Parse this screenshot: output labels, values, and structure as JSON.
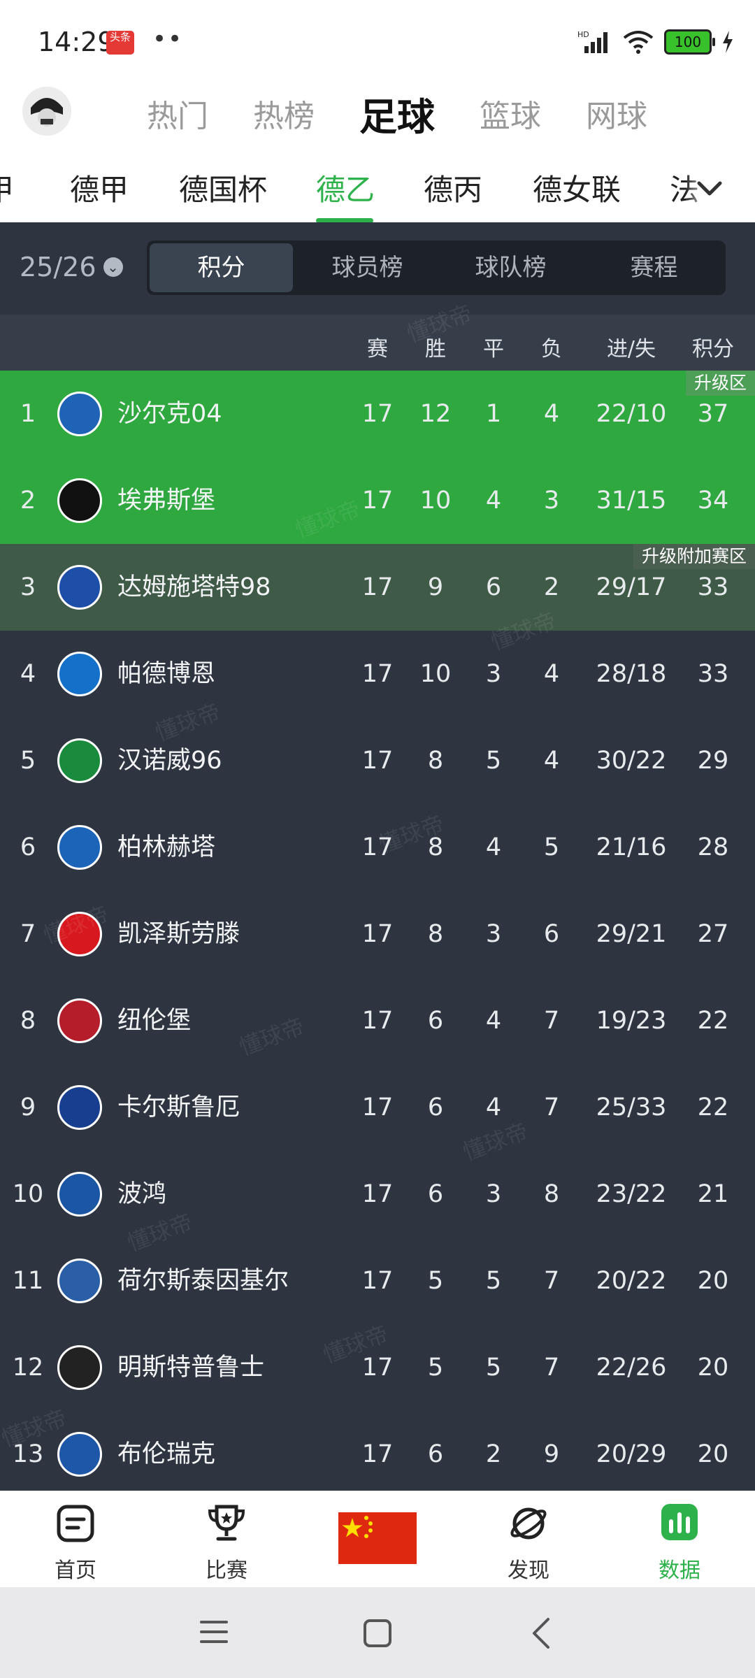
{
  "status_bar": {
    "time": "14:29",
    "badge": "头条",
    "battery": "100",
    "network": "HD"
  },
  "sport_tabs": [
    "热门",
    "热榜",
    "足球",
    "篮球",
    "网球"
  ],
  "sport_tabs_active": "足球",
  "league_tabs": [
    "甲",
    "德甲",
    "德国杯",
    "德乙",
    "德丙",
    "德女联",
    "法"
  ],
  "league_active": "德乙",
  "season": {
    "label": "25/26"
  },
  "segments": [
    "积分",
    "球员榜",
    "球队榜",
    "赛程"
  ],
  "segment_active": "积分",
  "table": {
    "headers": {
      "played": "赛",
      "won": "胜",
      "drawn": "平",
      "lost": "负",
      "goals": "进/失",
      "points": "积分"
    },
    "zones": {
      "promotion": "升级区",
      "playoff": "升级附加赛区"
    },
    "rows": [
      {
        "rank": "1",
        "team": "沙尔克04",
        "played": "17",
        "won": "12",
        "drawn": "1",
        "lost": "4",
        "goals": "22/10",
        "points": "37",
        "logo_color": "#1e63b5"
      },
      {
        "rank": "2",
        "team": "埃弗斯堡",
        "played": "17",
        "won": "10",
        "drawn": "4",
        "lost": "3",
        "goals": "31/15",
        "points": "34",
        "logo_color": "#111111"
      },
      {
        "rank": "3",
        "team": "达姆施塔特98",
        "played": "17",
        "won": "9",
        "drawn": "6",
        "lost": "2",
        "goals": "29/17",
        "points": "33",
        "logo_color": "#1d4fa8"
      },
      {
        "rank": "4",
        "team": "帕德博恩",
        "played": "17",
        "won": "10",
        "drawn": "3",
        "lost": "4",
        "goals": "28/18",
        "points": "33",
        "logo_color": "#1470c8"
      },
      {
        "rank": "5",
        "team": "汉诺威96",
        "played": "17",
        "won": "8",
        "drawn": "5",
        "lost": "4",
        "goals": "30/22",
        "points": "29",
        "logo_color": "#1a8a3c"
      },
      {
        "rank": "6",
        "team": "柏林赫塔",
        "played": "17",
        "won": "8",
        "drawn": "4",
        "lost": "5",
        "goals": "21/16",
        "points": "28",
        "logo_color": "#1b64b8"
      },
      {
        "rank": "7",
        "team": "凯泽斯劳滕",
        "played": "17",
        "won": "8",
        "drawn": "3",
        "lost": "6",
        "goals": "29/21",
        "points": "27",
        "logo_color": "#d7191f"
      },
      {
        "rank": "8",
        "team": "纽伦堡",
        "played": "17",
        "won": "6",
        "drawn": "4",
        "lost": "7",
        "goals": "19/23",
        "points": "22",
        "logo_color": "#b51d2a"
      },
      {
        "rank": "9",
        "team": "卡尔斯鲁厄",
        "played": "17",
        "won": "6",
        "drawn": "4",
        "lost": "7",
        "goals": "25/33",
        "points": "22",
        "logo_color": "#173e8f"
      },
      {
        "rank": "10",
        "team": "波鸿",
        "played": "17",
        "won": "6",
        "drawn": "3",
        "lost": "8",
        "goals": "23/22",
        "points": "21",
        "logo_color": "#1b56a5"
      },
      {
        "rank": "11",
        "team": "荷尔斯泰因基尔",
        "played": "17",
        "won": "5",
        "drawn": "5",
        "lost": "7",
        "goals": "20/22",
        "points": "20",
        "logo_color": "#2a5fa8"
      },
      {
        "rank": "12",
        "team": "明斯特普鲁士",
        "played": "17",
        "won": "5",
        "drawn": "5",
        "lost": "7",
        "goals": "22/26",
        "points": "20",
        "logo_color": "#222222"
      },
      {
        "rank": "13",
        "team": "布伦瑞克",
        "played": "17",
        "won": "6",
        "drawn": "2",
        "lost": "9",
        "goals": "20/29",
        "points": "20",
        "logo_color": "#1f57a8"
      }
    ]
  },
  "bottom_nav": {
    "items": [
      {
        "label": "首页",
        "icon": "home-icon"
      },
      {
        "label": "比赛",
        "icon": "trophy-icon"
      },
      {
        "label": "",
        "icon": "china-flag-icon"
      },
      {
        "label": "发现",
        "icon": "planet-icon"
      },
      {
        "label": "数据",
        "icon": "chart-icon"
      }
    ],
    "active": "数据"
  },
  "watermark": "懂球帝",
  "colors": {
    "accent": "#2db14a",
    "panel": "#2e3540",
    "promotion": "#2fa83f",
    "playoff": "#3f5a47"
  }
}
